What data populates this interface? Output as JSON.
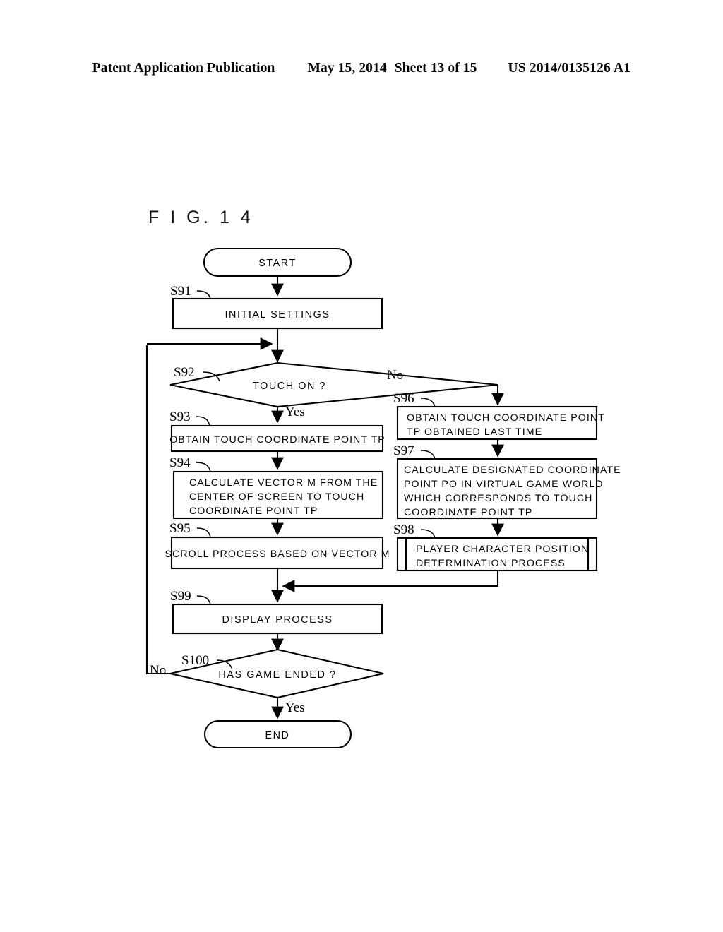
{
  "header": {
    "publication": "Patent Application Publication",
    "date": "May 15, 2014",
    "sheet": "Sheet 13 of 15",
    "document_number": "US 2014/0135126 A1"
  },
  "figure": {
    "label": "F I G.  1 4"
  },
  "flowchart": {
    "type": "flowchart",
    "terminals": {
      "start": "START",
      "end": "END"
    },
    "steps": [
      {
        "tag": "S91",
        "label": "INITIAL SETTINGS",
        "shape": "process"
      },
      {
        "tag": "S92",
        "label": "TOUCH ON ?",
        "shape": "decision"
      },
      {
        "tag": "S93",
        "label": "OBTAIN TOUCH COORDINATE POINT TP",
        "shape": "process"
      },
      {
        "tag": "S94",
        "line1": "CALCULATE VECTOR M FROM THE",
        "line2": "CENTER OF SCREEN TO TOUCH",
        "line3": "COORDINATE POINT TP",
        "shape": "process"
      },
      {
        "tag": "S95",
        "label": "SCROLL PROCESS BASED ON VECTOR M",
        "shape": "process"
      },
      {
        "tag": "S96",
        "line1": "OBTAIN TOUCH COORDINATE POINT",
        "line2": "TP OBTAINED LAST TIME",
        "shape": "process"
      },
      {
        "tag": "S97",
        "line1": "CALCULATE DESIGNATED COORDINATE",
        "line2": "POINT PO IN VIRTUAL GAME WORLD",
        "line3": "WHICH CORRESPONDS TO TOUCH",
        "line4": "COORDINATE POINT TP",
        "shape": "process"
      },
      {
        "tag": "S98",
        "line1": "PLAYER CHARACTER POSITION",
        "line2": "DETERMINATION PROCESS",
        "shape": "subroutine"
      },
      {
        "tag": "S99",
        "label": "DISPLAY PROCESS",
        "shape": "process"
      },
      {
        "tag": "S100",
        "label": "HAS GAME ENDED ?",
        "shape": "decision"
      }
    ],
    "branch_labels": {
      "s92_yes": "Yes",
      "s92_no": "No",
      "s100_yes": "Yes",
      "s100_no": "No"
    },
    "colors": {
      "line": "#000000",
      "fill": "#ffffff",
      "text": "#000000"
    }
  }
}
